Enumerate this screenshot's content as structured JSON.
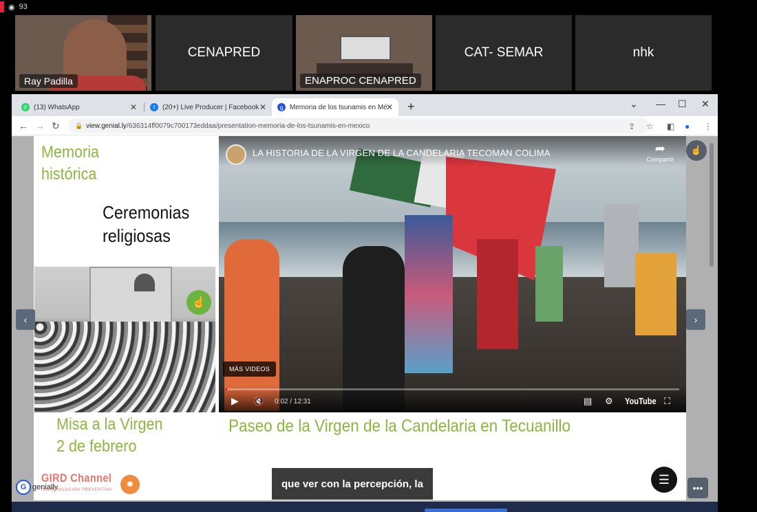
{
  "meeting": {
    "viewer_count": "93",
    "participants": [
      {
        "name": "Ray Padilla"
      },
      {
        "name": "CENAPRED"
      },
      {
        "name": "ENAPROC CENAPRED"
      },
      {
        "name": "CAT- SEMAR"
      },
      {
        "name": "nhk"
      }
    ]
  },
  "browser": {
    "tabs": [
      {
        "label": "(13) WhatsApp",
        "icon": "whatsapp-icon",
        "color": "#25d366"
      },
      {
        "label": "(20+) Live Producer | Facebook",
        "icon": "facebook-icon",
        "color": "#1877f2"
      },
      {
        "label": "Memoria de los tsunamis en Mé",
        "icon": "genially-icon",
        "color": "#2355d6"
      }
    ],
    "url_host": "view.genial.ly",
    "url_path": "/636314ff0079c700173eddaa/presentation-memoria-de-los-tsunamis-en-mexico"
  },
  "slide": {
    "heading_line1": "Memoria",
    "heading_line2": "histórica",
    "subheading_line1": "Ceremonias",
    "subheading_line2": "religiosas",
    "photo_caption_line1": "Misa a la Virgen",
    "photo_caption_line2": "2 de febrero",
    "video_caption": "Paseo de la Virgen de la Candelaria en Tecuanillo",
    "accent_color": "#8db53f"
  },
  "video": {
    "title": "LA HISTORIA DE LA VIRGEN DE LA CANDELARIA TECOMAN COLIMA",
    "share_label": "Compartir",
    "more_videos_label": "MÁS VIDEOS",
    "time": "0:02 / 12:31",
    "progress": 0.003,
    "brand": "YouTube"
  },
  "footer": {
    "channel_name": "GIRD Channel",
    "channel_tagline": "COMUNICACIÓN PREVENTIVA",
    "genially_label": "genially",
    "subtitle": "que ver con la percepción, la"
  }
}
